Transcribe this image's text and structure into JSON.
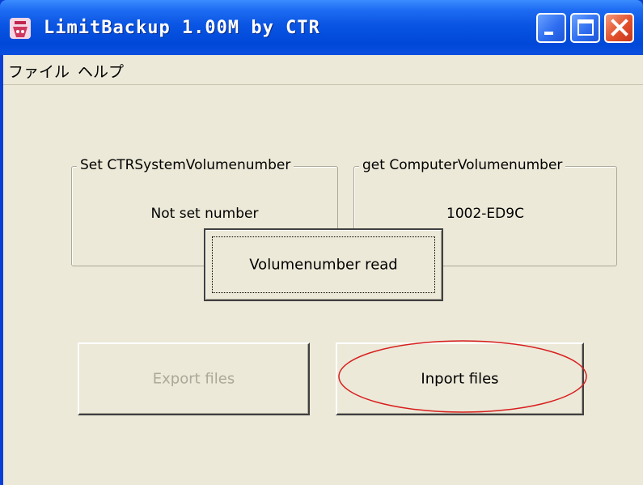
{
  "window": {
    "title": "LimitBackup 1.00M by CTR",
    "icon": "app-icon",
    "controls": [
      "minimize-icon",
      "maximize-icon",
      "close-icon"
    ]
  },
  "menu": {
    "file_label": "ファイル",
    "help_label": "ヘルプ"
  },
  "groups": {
    "set_system": {
      "legend": "Set CTRSystemVolumenumber",
      "value": "Not set number"
    },
    "get_computer": {
      "legend": "get ComputerVolumenumber",
      "value": "1002-ED9C"
    }
  },
  "buttons": {
    "read_label": "Volumenumber read",
    "export_label": "Export files",
    "import_label": "Inport files"
  },
  "colors": {
    "titlebar": "#0a55e3",
    "client_bg": "#ece9d8",
    "disabled_text": "#aca899",
    "annotation_red": "#d81e1e"
  }
}
